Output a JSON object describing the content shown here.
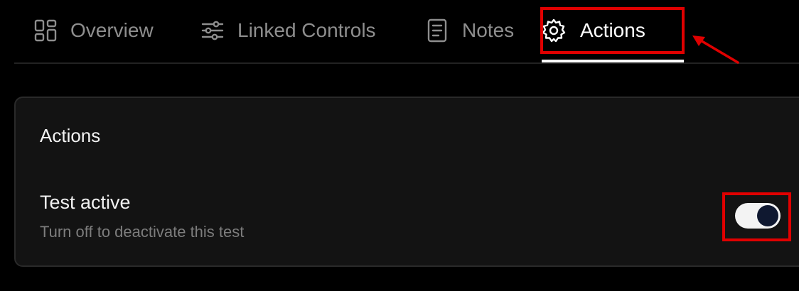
{
  "tabs": {
    "overview": {
      "label": "Overview",
      "icon": "grid-icon"
    },
    "linked_controls": {
      "label": "Linked Controls",
      "icon": "sliders-icon"
    },
    "notes": {
      "label": "Notes",
      "icon": "document-icon"
    },
    "actions": {
      "label": "Actions",
      "icon": "gear-icon",
      "active": true
    }
  },
  "card": {
    "title": "Actions",
    "setting": {
      "title": "Test active",
      "description": "Turn off to deactivate this test",
      "enabled": true
    }
  },
  "colors": {
    "background": "#000000",
    "card_background": "#131313",
    "highlight": "#e00000",
    "toggle_track": "#f3f3f3",
    "toggle_knob": "#0f1830"
  }
}
